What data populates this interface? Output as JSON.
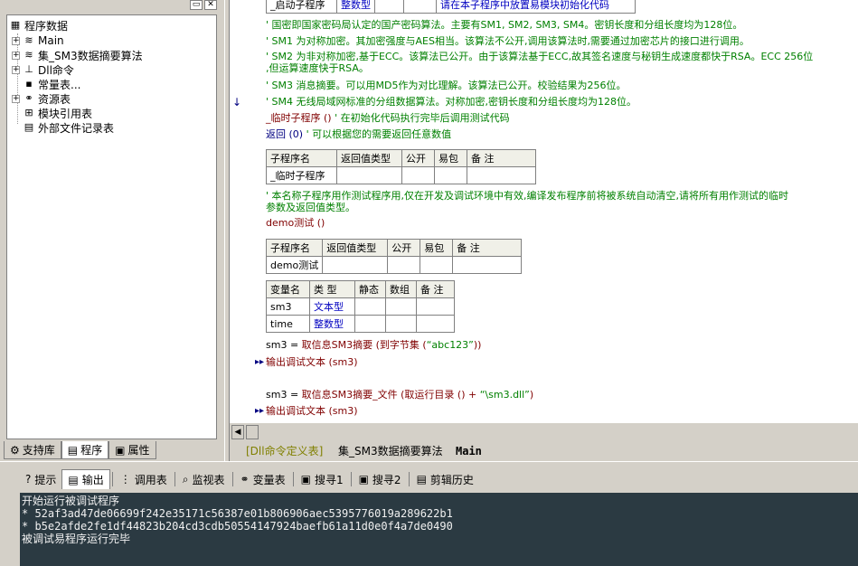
{
  "tree": {
    "root": "程序数据",
    "items": [
      {
        "label": "Main",
        "icon": "module-icon",
        "expand": "+"
      },
      {
        "label": "集_SM3数据摘要算法",
        "icon": "module-icon",
        "expand": "+"
      },
      {
        "label": "Dll命令",
        "icon": "dll-icon",
        "expand": "+"
      },
      {
        "label": "常量表...",
        "icon": "constant-icon",
        "expand": ""
      },
      {
        "label": "资源表",
        "icon": "resource-icon",
        "expand": "+"
      },
      {
        "label": "模块引用表",
        "icon": "module-ref-icon",
        "expand": ""
      },
      {
        "label": "外部文件记录表",
        "icon": "file-record-icon",
        "expand": ""
      }
    ]
  },
  "left_tabs": [
    "支持库",
    "程序",
    "属性"
  ],
  "editor": {
    "top_row": {
      "name": "_启动子程序",
      "type": "整数型",
      "note": "请在本子程序中放置易模块初始化代码"
    },
    "comments": [
      "' 国密即国家密码局认定的国产密码算法。主要有SM1, SM2, SM3, SM4。密钥长度和分组长度均为128位。",
      "' SM1 为对称加密。其加密强度与AES相当。该算法不公开,调用该算法时,需要通过加密芯片的接口进行调用。",
      "' SM2 为非对称加密,基于ECC。该算法已公开。由于该算法基于ECC,故其签名速度与秘钥生成速度都快于RSA。ECC 256位",
      ",但运算速度快于RSA。",
      "' SM3 消息摘要。可以用MD5作为对比理解。该算法已公开。校验结果为256位。",
      "' SM4 无线局域网标准的分组数据算法。对称加密,密钥长度和分组长度均为128位。"
    ],
    "tmp_sub_line": "_临时子程序 ()",
    "tmp_sub_comment": "' 在初始化代码执行完毕后调用测试代码",
    "return_line": "返回 (0)",
    "return_comment": "' 可以根据您的需要返回任意数值",
    "sub_headers": [
      "子程序名",
      "返回值类型",
      "公开",
      "易包",
      "备 注"
    ],
    "tmp_sub_name": "_临时子程序",
    "tmp_comments": [
      "' 本名称子程序用作测试程序用,仅在开发及调试环境中有效,编译发布程序前将被系统自动清空,请将所有用作测试的临时",
      "参数及返回值类型。"
    ],
    "demo_call": "demo测试 ()",
    "demo_name": "demo测试",
    "var_headers": [
      "变量名",
      "类 型",
      "静态",
      "数组",
      "备 注"
    ],
    "vars": [
      {
        "name": "sm3",
        "type": "文本型"
      },
      {
        "name": "time",
        "type": "整数型"
      }
    ],
    "code": [
      {
        "lhs": "sm3 = ",
        "fn": "取信息SM3摘要",
        "args": " (到字节集 (",
        "str": "“abc123”",
        "end": "))"
      },
      {
        "lhs": "",
        "fn": "输出调试文本",
        "args": " (sm3)",
        "str": "",
        "end": ""
      },
      {
        "lhs": "sm3 = ",
        "fn": "取信息SM3摘要_文件",
        "args": " (取运行目录 () + ",
        "str": "“\\sm3.dll”",
        "end": ")"
      },
      {
        "lhs": "",
        "fn": "输出调试文本",
        "args": " (sm3)",
        "str": "",
        "end": ""
      }
    ]
  },
  "editor_tabs": [
    "[Dll命令定义表]",
    "集_SM3数据摘要算法",
    "Main"
  ],
  "bottom_tabs": [
    "提示",
    "输出",
    "调用表",
    "监视表",
    "变量表",
    "搜寻1",
    "搜寻2",
    "剪辑历史"
  ],
  "output": [
    "开始运行被调试程序",
    "* 52af3ad47de06699f242e35171c56387e01b806906aec5395776019a289622b1",
    "* b5e2afde2fe1df44823b204cd3cdb50554147924baefb61a11d0e0f4a7de0490",
    "被调试易程序运行完毕"
  ]
}
